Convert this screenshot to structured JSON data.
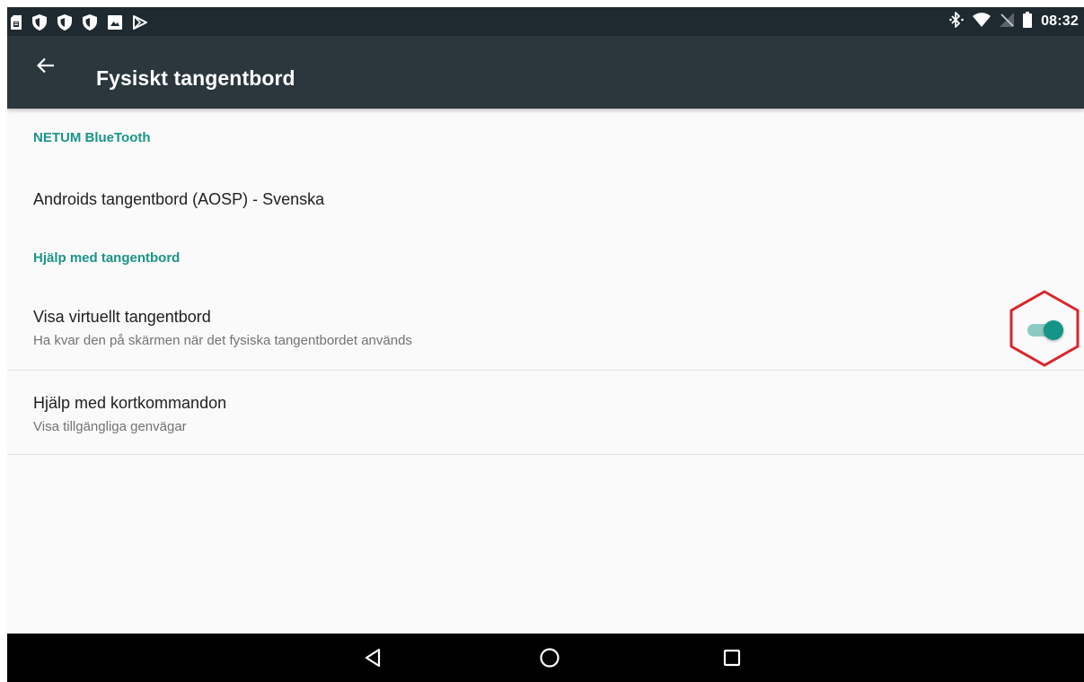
{
  "status_bar": {
    "time": "08:32",
    "left_icons": [
      "sim-card-icon",
      "shield-icon",
      "shield-icon",
      "shield-icon",
      "photo-icon",
      "play-store-icon"
    ],
    "right_icons": [
      "bluetooth-icon",
      "wifi-icon",
      "no-signal-icon",
      "battery-icon"
    ]
  },
  "app_bar": {
    "title": "Fysiskt tangentbord",
    "back_icon": "back-arrow-icon"
  },
  "sections": [
    {
      "header": "NETUM BlueTooth",
      "items": [
        {
          "title": "Androids tangentbord (AOSP) - Svenska"
        }
      ]
    },
    {
      "header": "Hjälp med tangentbord",
      "items": [
        {
          "title": "Visa virtuellt tangentbord",
          "summary": "Ha kvar den på skärmen när det fysiska tangentbordet används",
          "toggle_on": true
        },
        {
          "title": "Hjälp med kortkommandon",
          "summary": "Visa tillgängliga genvägar"
        }
      ]
    }
  ],
  "nav_bar": {
    "buttons": [
      "back-triangle-icon",
      "home-circle-icon",
      "recents-square-icon"
    ]
  },
  "colors": {
    "status_bar": "#1f2a30",
    "app_bar": "#2b373d",
    "accent": "#1a9588",
    "toggle_track": "#8dcac3",
    "toggle_thumb": "#159488",
    "highlight": "#d9262b",
    "background": "#fafafa"
  }
}
